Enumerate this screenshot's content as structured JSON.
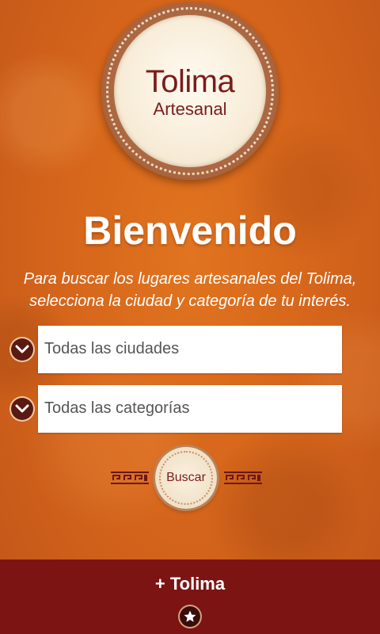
{
  "logo": {
    "title": "Tolima",
    "subtitle": "Artesanal"
  },
  "welcome": "Bienvenido",
  "intro": "Para buscar los lugares artesanales del Tolima, selecciona la ciudad y categoría de tu interés.",
  "city_select": {
    "value": "Todas las ciudades",
    "icon": "chevron-down-icon"
  },
  "category_select": {
    "value": "Todas las categorías",
    "icon": "chevron-down-icon"
  },
  "search_button": {
    "label": "Buscar"
  },
  "footer": {
    "title": "+ Tolima",
    "icon": "star-icon"
  },
  "colors": {
    "background": "#d6661b",
    "footer": "#7c1414",
    "logo_text": "#7a1c1c",
    "chevron_bg": "#5a1a12"
  }
}
